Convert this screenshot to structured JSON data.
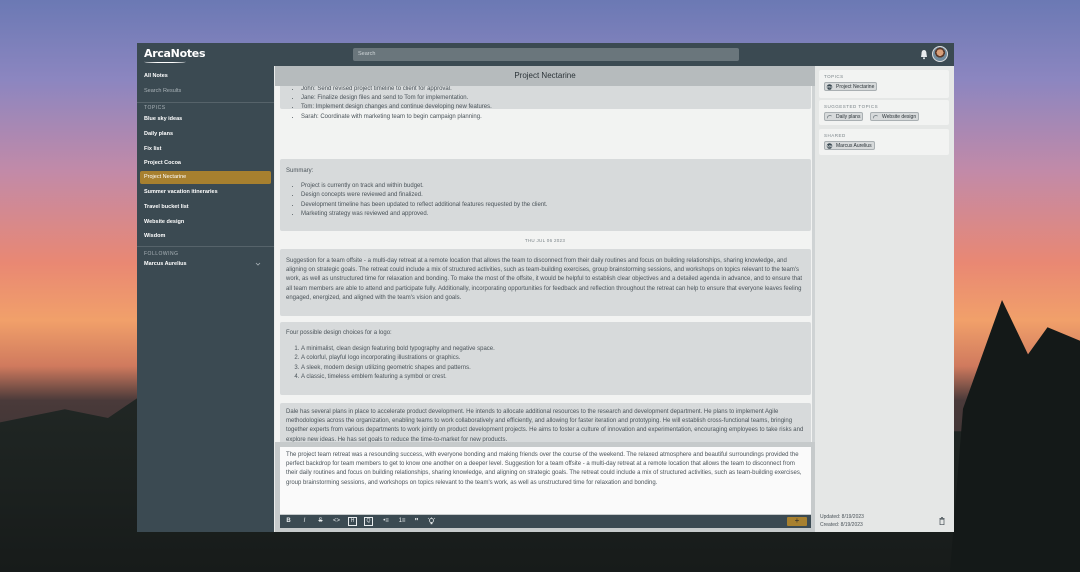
{
  "app": {
    "logo": "ArcaNotes",
    "search_placeholder": "Search"
  },
  "sidebar": {
    "all_notes": "All Notes",
    "search_results": "Search Results",
    "topics_heading": "TOPICS",
    "topics": [
      "Blue sky ideas",
      "Daily plans",
      "Fix list",
      "Project Cocoa",
      "Project Nectarine",
      "Summer vacation itineraries",
      "Travel bucket list",
      "Website design",
      "Wisdom"
    ],
    "active_topic": "Project Nectarine",
    "following_heading": "FOLLOWING",
    "following": [
      "Marcus Aurelius"
    ]
  },
  "center": {
    "title": "Project Nectarine",
    "note1_items": [
      "John: Send revised project timeline to client for approval.",
      "Jane: Finalize design files and send to Tom for implementation.",
      "Tom: Implement design changes and continue developing new features.",
      "Sarah: Coordinate with marketing team to begin campaign planning."
    ],
    "note2_heading": "Summary:",
    "note2_items": [
      "Project is currently on track and within budget.",
      "Design concepts were reviewed and finalized.",
      "Development timeline has been updated to reflect additional features requested by the client.",
      "Marketing strategy was reviewed and approved."
    ],
    "date_label": "THU JUL 06 2023",
    "note3_text": "Suggestion for a team offsite - a multi-day retreat at a remote location that allows the team to disconnect from their daily routines and focus on building relationships, sharing knowledge, and aligning on strategic goals. The retreat could include a mix of structured activities, such as team-building exercises, group brainstorming sessions, and workshops on topics relevant to the team's work, as well as unstructured time for relaxation and bonding. To make the most of the offsite, it would be helpful to establish clear objectives and a detailed agenda in advance, and to ensure that all team members are able to attend and participate fully. Additionally, incorporating opportunities for feedback and reflection throughout the retreat can help to ensure that everyone leaves feeling engaged, energized, and aligned with the team's vision and goals.",
    "note4_heading": "Four possible design choices for a logo:",
    "note4_items": [
      "A minimalist, clean design featuring bold typography and negative space.",
      "A colorful, playful logo incorporating illustrations or graphics.",
      "A sleek, modern design utilizing geometric shapes and patterns.",
      "A classic, timeless emblem featuring a symbol or crest."
    ],
    "note5_text": "Dale has several plans in place to accelerate product development. He intends to allocate additional resources to the research and development department. He plans to implement Agile methodologies across the organization, enabling teams to work collaboratively and efficiently, and allowing for faster iteration and prototyping. He will establish cross-functional teams, bringing together experts from various departments to work jointly on product development projects. He aims to foster a culture of innovation and experimentation, encouraging employees to take risks and explore new ideas. He has set goals to reduce the time-to-market for new products.",
    "composer_text": "The project team retreat was a resounding success, with everyone bonding and making friends over the course of the weekend. The relaxed atmosphere and beautiful surroundings provided the perfect backdrop for team members to get to know one another on a deeper level. Suggestion for a team offsite - a multi-day retreat at a remote location that allows the team to disconnect from their daily routines and focus on building relationships, sharing knowledge, and aligning on strategic goals. The retreat could include a mix of structured activities, such as team-building exercises, group brainstorming sessions, and workshops on topics relevant to the team's work, as well as unstructured time for relaxation and bonding.",
    "toolbar": [
      "B",
      "I",
      "S",
      "<>",
      "H",
      "Q",
      "•≡",
      "1≡",
      "\"",
      "light-bulb-icon"
    ],
    "add_label": "+"
  },
  "right": {
    "topics_heading": "TOPICS",
    "topics": [
      "Project Nectarine"
    ],
    "suggested_heading": "SUGGESTED TOPICS",
    "suggested": [
      "Daily plans",
      "Website design"
    ],
    "shared_heading": "SHARED",
    "shared": [
      "Marcus Aurelius"
    ],
    "updated": "Updated: 8/19/2023",
    "created": "Created: 8/19/2023"
  },
  "colors": {
    "chrome": "#3b4a52",
    "accent": "#a7802f",
    "note_bg": "#d7dadb"
  }
}
